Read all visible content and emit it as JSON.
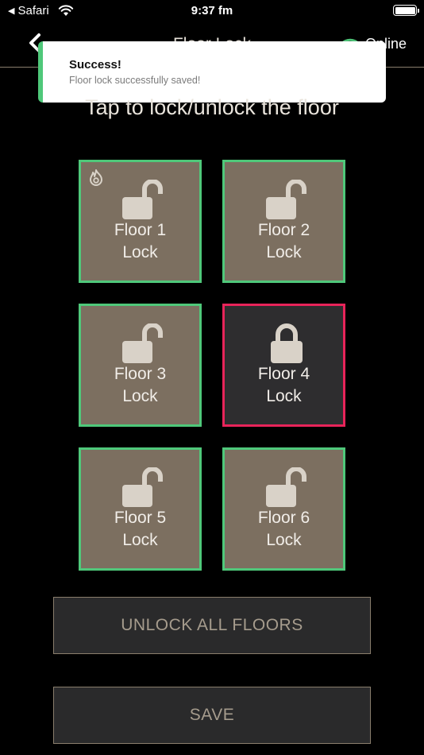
{
  "status_bar": {
    "back_app": "Safari",
    "time": "9:37 fm"
  },
  "nav": {
    "title": "Floor Lock",
    "connection_status": "Online"
  },
  "toast": {
    "title": "Success!",
    "message": "Floor lock successfully saved!",
    "accent_color": "#4fc87a"
  },
  "instruction": "Tap to lock/unlock the floor",
  "floors": [
    {
      "line1": "Floor 1",
      "line2": "Lock",
      "state": "unlocked",
      "has_flame_icon": true
    },
    {
      "line1": "Floor 2",
      "line2": "Lock",
      "state": "unlocked"
    },
    {
      "line1": "Floor 3",
      "line2": "Lock",
      "state": "unlocked"
    },
    {
      "line1": "Floor 4",
      "line2": "Lock",
      "state": "locked"
    },
    {
      "line1": "Floor 5",
      "line2": "Lock",
      "state": "unlocked"
    },
    {
      "line1": "Floor 6",
      "line2": "Lock",
      "state": "unlocked"
    }
  ],
  "colors": {
    "unlocked_border": "#4fc87a",
    "locked_border": "#e8245a",
    "tile_fill": "#7c6f60",
    "locked_fill": "#2e2d2f",
    "button_text": "#a69c8d"
  },
  "buttons": {
    "unlock_all": "UNLOCK ALL FLOORS",
    "save": "SAVE"
  }
}
